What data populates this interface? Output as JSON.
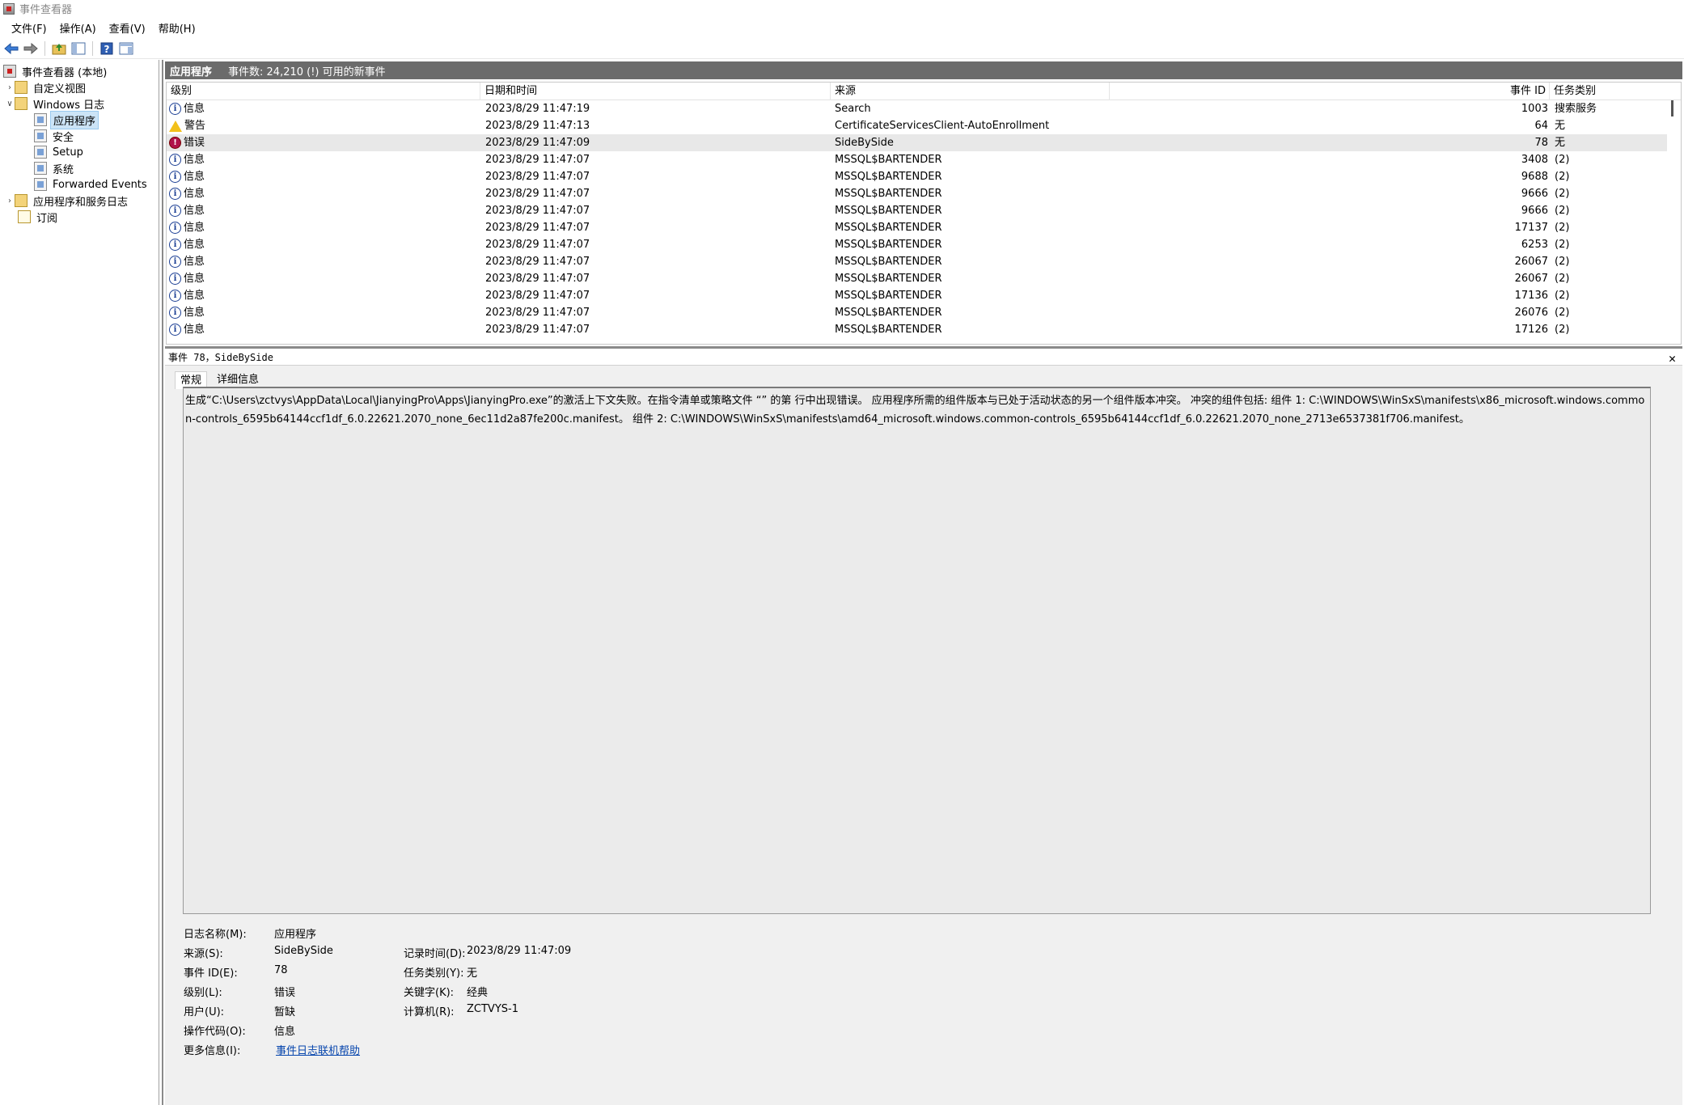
{
  "window": {
    "title": "事件查看器"
  },
  "menu": {
    "items": [
      "文件(F)",
      "操作(A)",
      "查看(V)",
      "帮助(H)"
    ]
  },
  "tree": {
    "root": "事件查看器 (本地)",
    "custom_views": "自定义视图",
    "windows_logs": "Windows 日志",
    "application": "应用程序",
    "security": "安全",
    "setup": "Setup",
    "system": "系统",
    "forwarded": "Forwarded Events",
    "app_service_logs": "应用程序和服务日志",
    "subscriptions": "订阅"
  },
  "panel": {
    "title": "应用程序",
    "event_count": "事件数: 24,210 (!) 可用的新事件"
  },
  "columns": {
    "level": "级别",
    "date": "日期和时间",
    "source": "来源",
    "event_id": "事件 ID",
    "task": "任务类别"
  },
  "events": [
    {
      "icon": "info",
      "level": "信息",
      "date": "2023/8/29 11:47:19",
      "source": "Search",
      "event_id": "1003",
      "task": "搜索服务"
    },
    {
      "icon": "warn",
      "level": "警告",
      "date": "2023/8/29 11:47:13",
      "source": "CertificateServicesClient-AutoEnrollment",
      "event_id": "64",
      "task": "无"
    },
    {
      "icon": "err",
      "level": "错误",
      "date": "2023/8/29 11:47:09",
      "source": "SideBySide",
      "event_id": "78",
      "task": "无"
    },
    {
      "icon": "info",
      "level": "信息",
      "date": "2023/8/29 11:47:07",
      "source": "MSSQL$BARTENDER",
      "event_id": "3408",
      "task": "(2)"
    },
    {
      "icon": "info",
      "level": "信息",
      "date": "2023/8/29 11:47:07",
      "source": "MSSQL$BARTENDER",
      "event_id": "9688",
      "task": "(2)"
    },
    {
      "icon": "info",
      "level": "信息",
      "date": "2023/8/29 11:47:07",
      "source": "MSSQL$BARTENDER",
      "event_id": "9666",
      "task": "(2)"
    },
    {
      "icon": "info",
      "level": "信息",
      "date": "2023/8/29 11:47:07",
      "source": "MSSQL$BARTENDER",
      "event_id": "9666",
      "task": "(2)"
    },
    {
      "icon": "info",
      "level": "信息",
      "date": "2023/8/29 11:47:07",
      "source": "MSSQL$BARTENDER",
      "event_id": "17137",
      "task": "(2)"
    },
    {
      "icon": "info",
      "level": "信息",
      "date": "2023/8/29 11:47:07",
      "source": "MSSQL$BARTENDER",
      "event_id": "6253",
      "task": "(2)"
    },
    {
      "icon": "info",
      "level": "信息",
      "date": "2023/8/29 11:47:07",
      "source": "MSSQL$BARTENDER",
      "event_id": "26067",
      "task": "(2)"
    },
    {
      "icon": "info",
      "level": "信息",
      "date": "2023/8/29 11:47:07",
      "source": "MSSQL$BARTENDER",
      "event_id": "26067",
      "task": "(2)"
    },
    {
      "icon": "info",
      "level": "信息",
      "date": "2023/8/29 11:47:07",
      "source": "MSSQL$BARTENDER",
      "event_id": "17136",
      "task": "(2)"
    },
    {
      "icon": "info",
      "level": "信息",
      "date": "2023/8/29 11:47:07",
      "source": "MSSQL$BARTENDER",
      "event_id": "26076",
      "task": "(2)"
    },
    {
      "icon": "info",
      "level": "信息",
      "date": "2023/8/29 11:47:07",
      "source": "MSSQL$BARTENDER",
      "event_id": "17126",
      "task": "(2)"
    }
  ],
  "detail": {
    "header": "事件 78，SideBySide",
    "tab_general": "常规",
    "tab_details": "详细信息",
    "description": "生成“C:\\Users\\zctvys\\AppData\\Local\\JianyingPro\\Apps\\JianyingPro.exe”的激活上下文失败。在指令清单或策略文件 “” 的第  行中出现错误。 应用程序所需的组件版本与已处于活动状态的另一个组件版本冲突。 冲突的组件包括: 组件 1: C:\\WINDOWS\\WinSxS\\manifests\\x86_microsoft.windows.common-controls_6595b64144ccf1df_6.0.22621.2070_none_6ec11d2a87fe200c.manifest。 组件 2: C:\\WINDOWS\\WinSxS\\manifests\\amd64_microsoft.windows.common-controls_6595b64144ccf1df_6.0.22621.2070_none_2713e6537381f706.manifest。",
    "labels": {
      "log_name": "日志名称(M):",
      "source": "来源(S):",
      "event_id": "事件 ID(E):",
      "level": "级别(L):",
      "user": "用户(U):",
      "opcode": "操作代码(O):",
      "more_info": "更多信息(I):",
      "logged": "记录时间(D):",
      "task": "任务类别(Y):",
      "keywords": "关键字(K):",
      "computer": "计算机(R):"
    },
    "values": {
      "log_name": "应用程序",
      "source": "SideBySide",
      "event_id": "78",
      "level": "错误",
      "user": "暂缺",
      "opcode": "信息",
      "more_info": "事件日志联机帮助",
      "logged": "2023/8/29 11:47:09",
      "task": "无",
      "keywords": "经典",
      "computer": "ZCTVYS-1"
    }
  }
}
